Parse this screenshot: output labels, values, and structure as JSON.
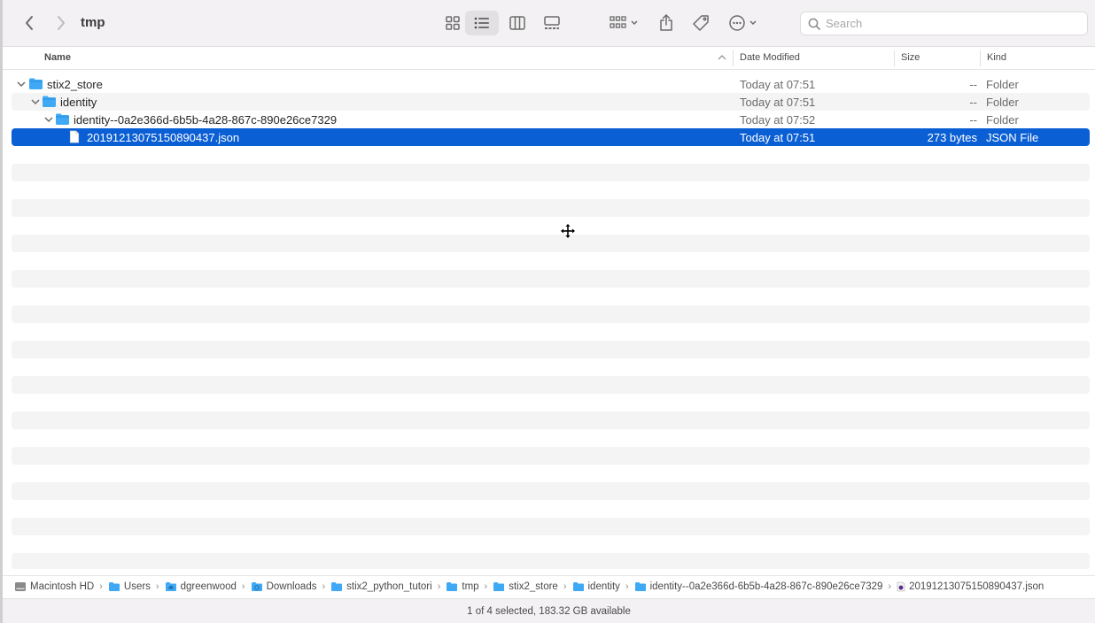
{
  "toolbar": {
    "title": "tmp",
    "search_placeholder": "Search",
    "icons": [
      "chevron-left-icon",
      "chevron-right-icon",
      "icon-view-icon",
      "list-view-icon",
      "column-view-icon",
      "gallery-view-icon",
      "group-icon",
      "share-icon",
      "tag-icon",
      "more-icon",
      "search-icon"
    ]
  },
  "columns": {
    "name": "Name",
    "date": "Date Modified",
    "size": "Size",
    "kind": "Kind"
  },
  "rows": [
    {
      "name": "stix2_store",
      "date": "Today at 07:51",
      "size": "--",
      "kind": "Folder",
      "type": "folder",
      "level": 0,
      "expanded": true,
      "selected": false
    },
    {
      "name": "identity",
      "date": "Today at 07:51",
      "size": "--",
      "kind": "Folder",
      "type": "folder",
      "level": 1,
      "expanded": true,
      "selected": false
    },
    {
      "name": "identity--0a2e366d-6b5b-4a28-867c-890e26ce7329",
      "date": "Today at 07:52",
      "size": "--",
      "kind": "Folder",
      "type": "folder",
      "level": 2,
      "expanded": true,
      "selected": false
    },
    {
      "name": "20191213075150890437.json",
      "date": "Today at 07:51",
      "size": "273 bytes",
      "kind": "JSON File",
      "type": "file",
      "level": 3,
      "expanded": false,
      "selected": true
    }
  ],
  "pathbar": [
    {
      "label": "Macintosh HD",
      "icon": "disk-icon"
    },
    {
      "label": "Users",
      "icon": "folder-icon"
    },
    {
      "label": "dgreenwood",
      "icon": "home-folder-icon"
    },
    {
      "label": "Downloads",
      "icon": "downloads-folder-icon"
    },
    {
      "label": "stix2_python_tutori",
      "icon": "folder-icon"
    },
    {
      "label": "tmp",
      "icon": "folder-icon"
    },
    {
      "label": "stix2_store",
      "icon": "folder-icon"
    },
    {
      "label": "identity",
      "icon": "folder-icon"
    },
    {
      "label": "identity--0a2e366d-6b5b-4a28-867c-890e26ce7329",
      "icon": "folder-icon"
    },
    {
      "label": "20191213075150890437.json",
      "icon": "json-file-icon"
    }
  ],
  "status": "1 of 4 selected, 183.32 GB available",
  "colors": {
    "selection": "#0b5fd4",
    "folder": "#3fa9f5",
    "stripe": "#f4f4f4"
  }
}
